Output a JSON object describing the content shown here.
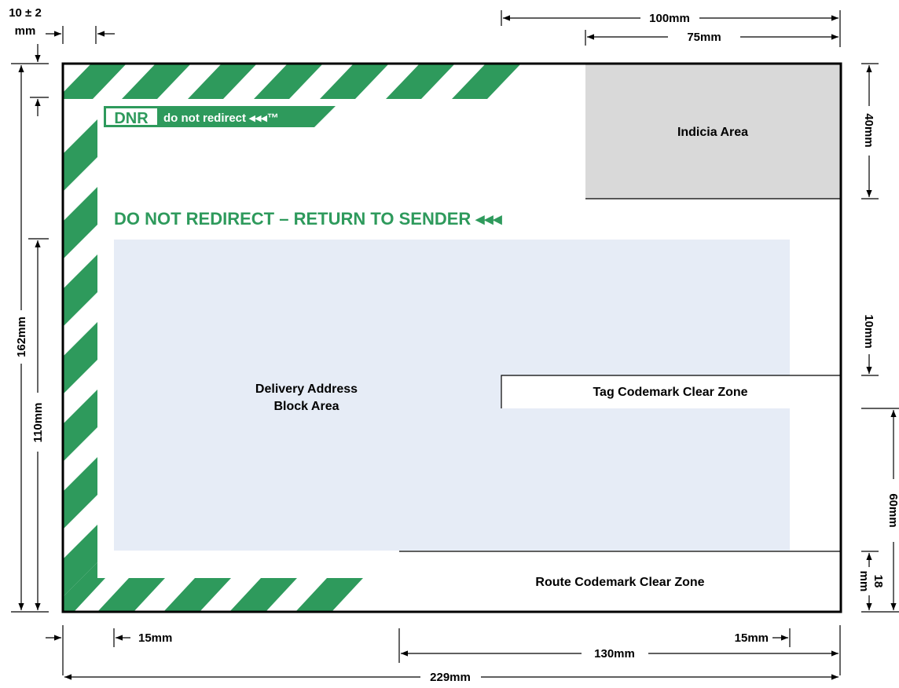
{
  "colors": {
    "green": "#2e9a5c",
    "indicia_gray": "#d9d9d9",
    "address_blue": "#e6ecf6",
    "line": "#000000"
  },
  "logo": {
    "brand": "DNR",
    "tagline": "do not redirect ◂◂◂™"
  },
  "heading": "DO NOT REDIRECT – RETURN TO SENDER ◂◂◂",
  "zones": {
    "indicia": "Indicia Area",
    "delivery_line1": "Delivery Address",
    "delivery_line2": "Block Area",
    "tag_codemark": "Tag Codemark Clear Zone",
    "route_codemark": "Route Codemark Clear Zone"
  },
  "dimensions": {
    "edge_offset_line1": "10 ± 2",
    "edge_offset_line2": "mm",
    "top_100": "100mm",
    "top_75": "75mm",
    "left_162": "162mm",
    "left_110": "110mm",
    "right_40": "40mm",
    "right_10": "10mm",
    "right_60": "60mm",
    "right_18_line1": "18",
    "right_18_line2": "mm",
    "bottom_15_left": "15mm",
    "bottom_15_right": "15mm",
    "bottom_130": "130mm",
    "bottom_229": "229mm"
  }
}
